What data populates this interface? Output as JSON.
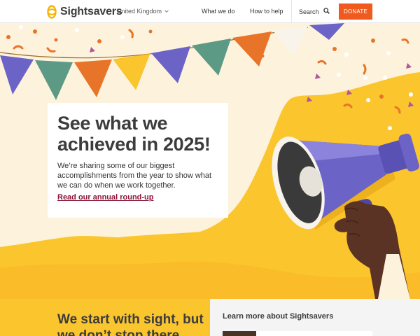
{
  "header": {
    "brand": "Sightsavers",
    "region": "United Kingdom",
    "nav": {
      "what_we_do": "What we do",
      "how_to_help": "How to help",
      "search": "Search"
    },
    "donate_label": "DONATE"
  },
  "hero": {
    "title": "See what we achieved in 2025!",
    "body": "We’re sharing some of our biggest accomplishments from the year to show what we can do when we work together.",
    "link": "Read our annual round-up"
  },
  "sections": {
    "intro_title": "We start with sight, but we don’t stop there",
    "learn_more_title": "Learn more about Sightsavers"
  },
  "colors": {
    "accent_orange": "#f05a1e",
    "brand_yellow": "#fbc52d",
    "link_maroon": "#8a1538",
    "megaphone_purple": "#6c63c7"
  },
  "icons": {
    "logo": "sightsavers-logo",
    "region_chevron": "chevron-down-icon",
    "search": "search-icon",
    "hero_illustration": "megaphone-illustration"
  }
}
